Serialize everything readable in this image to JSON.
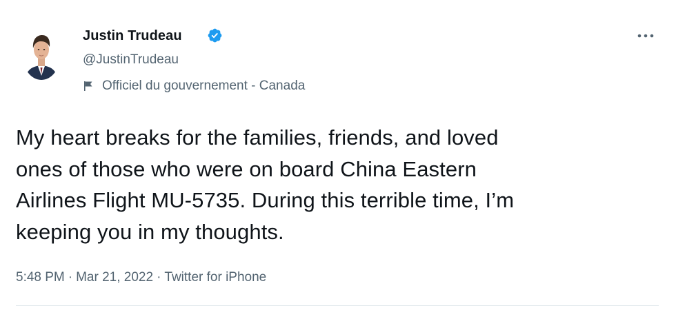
{
  "author": {
    "name": "Justin Trudeau",
    "handle": "@JustinTrudeau",
    "verified": true,
    "affiliation": "Officiel du gouvernement - Canada"
  },
  "tweet": {
    "text": "My heart breaks for the families, friends, and loved\nones of those who were on board China Eastern\nAirlines Flight MU-5735. During this terrible time, I’m\nkeeping you in my thoughts.",
    "time": "5:48 PM",
    "date": "Mar 21, 2022",
    "separator": "·",
    "source": "Twitter for iPhone"
  },
  "icons": {
    "avatar": "profile-photo",
    "verified": "verified-badge-icon",
    "affiliation": "flag-icon",
    "more": "more-options-icon"
  },
  "colors": {
    "text_primary": "#0f1419",
    "text_secondary": "#536471",
    "verified_blue": "#1d9bf0",
    "divider": "#e6ecf0"
  }
}
